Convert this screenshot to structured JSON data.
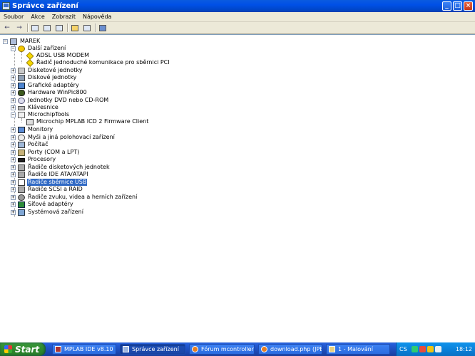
{
  "window": {
    "title": "Správce zařízení",
    "controls": {
      "minimize": "_",
      "maximize": "□",
      "close": "×"
    }
  },
  "menu": {
    "items": [
      "Soubor",
      "Akce",
      "Zobrazit",
      "Nápověda"
    ]
  },
  "toolbar": {
    "buttons": [
      {
        "name": "back",
        "icon": "arrow-left-icon",
        "glyph": "←"
      },
      {
        "name": "forward",
        "icon": "arrow-right-icon",
        "glyph": "→"
      },
      {
        "name": "up",
        "icon": "up-folder-icon"
      },
      {
        "name": "properties",
        "icon": "properties-icon"
      },
      {
        "name": "print",
        "icon": "print-icon"
      },
      {
        "name": "help",
        "icon": "help-icon"
      },
      {
        "name": "view",
        "icon": "view-icon"
      },
      {
        "name": "scan",
        "icon": "scan-hardware-icon"
      }
    ]
  },
  "tree": {
    "root": "MAREK",
    "nodes": [
      {
        "label": "Další zařízení",
        "level": 1,
        "expanded": true,
        "icon": "warning-icon"
      },
      {
        "label": "ADSL USB MODEM",
        "level": 2,
        "icon": "warning-icon"
      },
      {
        "label": "Řadič jednoduché komunikace pro sběrnici PCI",
        "level": 2,
        "icon": "warning-icon"
      },
      {
        "label": "Disketové jednotky",
        "level": 1,
        "expanded": false,
        "icon": "floppy-icon"
      },
      {
        "label": "Diskové jednotky",
        "level": 1,
        "expanded": false,
        "icon": "disk-drive-icon"
      },
      {
        "label": "Grafické adaptéry",
        "level": 1,
        "expanded": false,
        "icon": "display-adapter-icon"
      },
      {
        "label": "Hardware WinPic800",
        "level": 1,
        "expanded": false,
        "icon": "hardware-icon"
      },
      {
        "label": "Jednotky DVD nebo CD-ROM",
        "level": 1,
        "expanded": false,
        "icon": "cdrom-icon"
      },
      {
        "label": "Klávesnice",
        "level": 1,
        "expanded": false,
        "icon": "keyboard-icon"
      },
      {
        "label": "MicrochipTools",
        "level": 1,
        "expanded": true,
        "icon": "chip-icon"
      },
      {
        "label": "Microchip MPLAB ICD 2 Firmware Client",
        "level": 2,
        "icon": "chip-icon"
      },
      {
        "label": "Monitory",
        "level": 1,
        "expanded": false,
        "icon": "monitor-icon"
      },
      {
        "label": "Myši a jiná polohovací zařízení",
        "level": 1,
        "expanded": false,
        "icon": "mouse-icon"
      },
      {
        "label": "Počítač",
        "level": 1,
        "expanded": false,
        "icon": "computer-icon"
      },
      {
        "label": "Porty (COM a LPT)",
        "level": 1,
        "expanded": false,
        "icon": "port-icon"
      },
      {
        "label": "Procesory",
        "level": 1,
        "expanded": false,
        "icon": "processor-icon"
      },
      {
        "label": "Řadiče disketových jednotek",
        "level": 1,
        "expanded": false,
        "icon": "controller-icon"
      },
      {
        "label": "Řadiče IDE ATA/ATAPI",
        "level": 1,
        "expanded": false,
        "icon": "controller-icon"
      },
      {
        "label": "Řadiče sběrnice USB",
        "level": 1,
        "expanded": false,
        "icon": "usb-icon",
        "selected": true
      },
      {
        "label": "Řadiče SCSI a RAID",
        "level": 1,
        "expanded": false,
        "icon": "controller-icon"
      },
      {
        "label": "Řadiče zvuku, videa a herních zařízení",
        "level": 1,
        "expanded": false,
        "icon": "sound-icon"
      },
      {
        "label": "Síťové adaptéry",
        "level": 1,
        "expanded": false,
        "icon": "network-icon"
      },
      {
        "label": "Systémová zařízení",
        "level": 1,
        "expanded": false,
        "icon": "system-icon"
      }
    ]
  },
  "taskbar": {
    "start_label": "Start",
    "tasks": [
      {
        "label": "MPLAB IDE v8.10",
        "icon": "mplab-icon"
      },
      {
        "label": "Správce zařízení",
        "icon": "device-manager-icon",
        "active": true
      },
      {
        "label": "Fórum mcontrollers...",
        "icon": "firefox-icon"
      },
      {
        "label": "download.php (JPE...",
        "icon": "firefox-icon"
      },
      {
        "label": "1 - Malování",
        "icon": "paint-icon"
      }
    ],
    "tray": {
      "language": "CS",
      "clock": "18:12"
    }
  },
  "colors": {
    "title_bar": "#0050e6",
    "selection": "#316ac5",
    "start_button": "#2f8a2f",
    "taskbar": "#245edb",
    "tray": "#0b82da"
  }
}
